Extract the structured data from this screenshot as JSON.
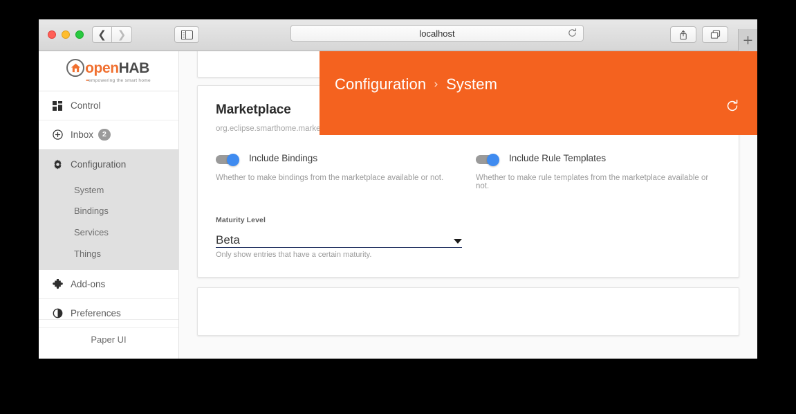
{
  "browser": {
    "url_text": "localhost",
    "back_icon": "chevron-left-icon",
    "forward_icon": "chevron-right-icon",
    "sidebar_icon": "sidebar-toggle-icon",
    "reload_icon": "reload-icon",
    "share_icon": "share-icon",
    "tabs_icon": "tabs-overview-icon",
    "new_tab_label": "+"
  },
  "sidebar": {
    "logo": {
      "word_primary": "open",
      "word_secondary": "HAB",
      "tagline": "empowering the smart home",
      "tagline_dots": "▪▪▪"
    },
    "items": [
      {
        "label": "Control",
        "icon": "dashboard-icon"
      },
      {
        "label": "Inbox",
        "icon": "plus-circle-icon",
        "badge": "2"
      },
      {
        "label": "Configuration",
        "icon": "gear-icon",
        "active": true
      },
      {
        "label": "Add-ons",
        "icon": "puzzle-piece-icon"
      },
      {
        "label": "Preferences",
        "icon": "contrast-icon"
      }
    ],
    "sub_items": [
      {
        "label": "System",
        "selected": true
      },
      {
        "label": "Bindings"
      },
      {
        "label": "Services"
      },
      {
        "label": "Things"
      }
    ],
    "footer_label": "Paper UI"
  },
  "topbar": {
    "breadcrumb_root": "Configuration",
    "breadcrumb_separator": "›",
    "breadcrumb_current": "System",
    "refresh_icon": "refresh-icon",
    "background_color": "#f4621f"
  },
  "marketplace_card": {
    "title": "Marketplace",
    "subtitle": "org.eclipse.smarthome.marketplace",
    "toggles": [
      {
        "label": "Include Bindings",
        "help": "Whether to make bindings from the marketplace available or not.",
        "state": "on",
        "knob_color": "#3f8bf0",
        "track_color": "#9a9a9a"
      },
      {
        "label": "Include Rule Templates",
        "help": "Whether to make rule templates from the marketplace available or not.",
        "state": "on",
        "knob_color": "#3f8bf0",
        "track_color": "#9a9a9a"
      }
    ],
    "select": {
      "label": "Maturity Level",
      "value": "Beta",
      "help": "Only show entries that have a certain maturity.",
      "caret_icon": "chevron-down-icon",
      "underline_color": "#2b3a67"
    }
  }
}
